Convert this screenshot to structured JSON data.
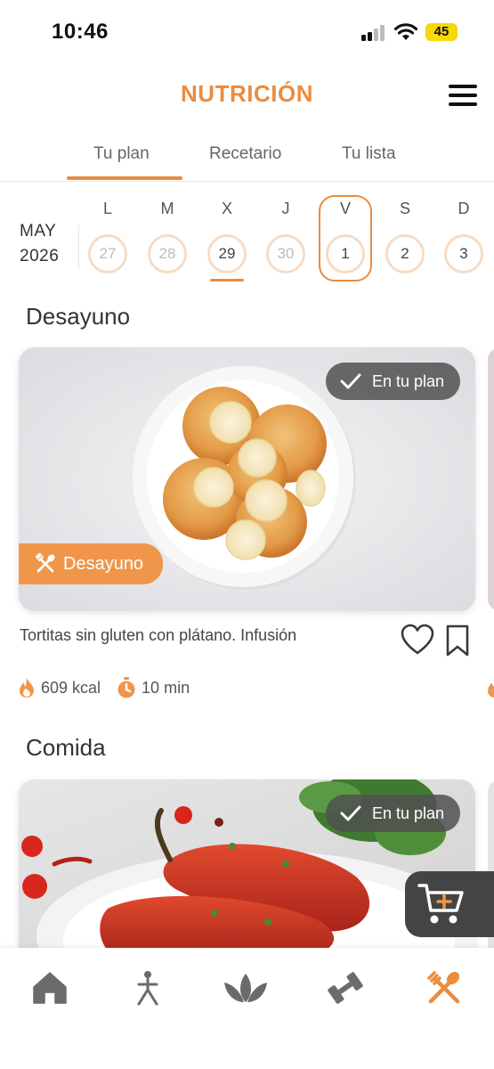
{
  "status_bar": {
    "time": "10:46",
    "battery": "45"
  },
  "header": {
    "title": "NUTRICIÓN",
    "menu_icon": "hamburger-menu-icon"
  },
  "tabs": [
    {
      "label": "Tu plan",
      "active": true
    },
    {
      "label": "Recetario",
      "active": false
    },
    {
      "label": "Tu lista",
      "active": false
    }
  ],
  "calendar": {
    "month": "MAY",
    "year": "2026",
    "days": [
      {
        "letter": "L",
        "number": "27",
        "state": "past"
      },
      {
        "letter": "M",
        "number": "28",
        "state": "past"
      },
      {
        "letter": "X",
        "number": "29",
        "state": "today"
      },
      {
        "letter": "J",
        "number": "30",
        "state": "past"
      },
      {
        "letter": "V",
        "number": "1",
        "state": "selected"
      },
      {
        "letter": "S",
        "number": "2",
        "state": "future"
      },
      {
        "letter": "D",
        "number": "3",
        "state": "future"
      }
    ]
  },
  "sections": {
    "breakfast": {
      "title": "Desayuno",
      "card": {
        "plan_badge": "En tu plan",
        "meal_tag": "Desayuno",
        "name": "Tortitas sin gluten con plátano. Infusión",
        "kcal": "609 kcal",
        "time": "10 min"
      }
    },
    "lunch": {
      "title": "Comida",
      "card": {
        "plan_badge": "En tu plan"
      }
    }
  },
  "cart_button": {
    "icon": "cart-add-icon"
  },
  "bottom_nav": [
    {
      "name": "home",
      "icon": "home-icon",
      "active": false
    },
    {
      "name": "posture",
      "icon": "person-posture-icon",
      "active": false
    },
    {
      "name": "wellness",
      "icon": "lotus-icon",
      "active": false
    },
    {
      "name": "training",
      "icon": "dumbbell-icon",
      "active": false
    },
    {
      "name": "nutrition",
      "icon": "fork-spoon-icon",
      "active": true
    }
  ],
  "colors": {
    "accent": "#eb8c3f",
    "tag": "#f0964a",
    "badge_bg": "#505050",
    "inactive_icon": "#6b6b6b"
  }
}
